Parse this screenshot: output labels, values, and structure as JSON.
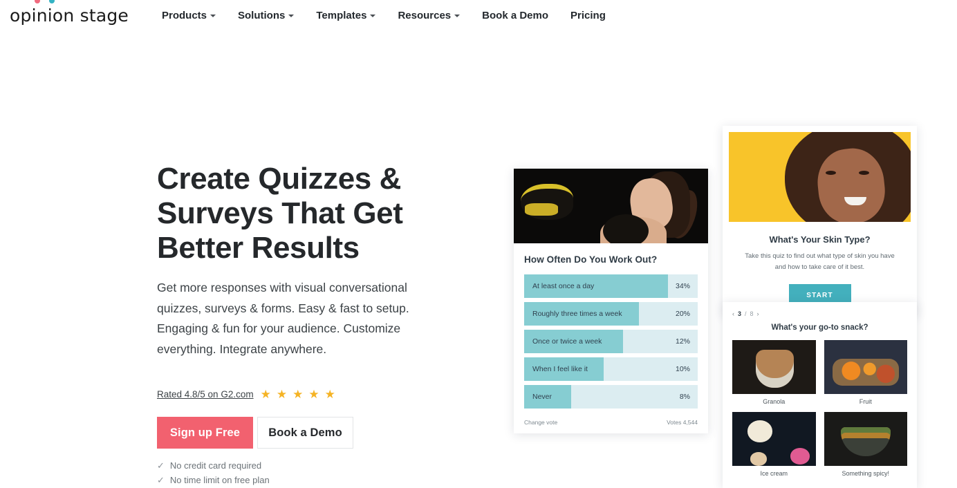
{
  "nav": {
    "logo_text": "opinion stage",
    "logo_dot_colors": [
      "#f06a7e",
      "#34b3c4"
    ],
    "items": [
      {
        "label": "Products",
        "has_dropdown": true,
        "icon": "chevron-down-icon"
      },
      {
        "label": "Solutions",
        "has_dropdown": true,
        "icon": "chevron-down-icon"
      },
      {
        "label": "Templates",
        "has_dropdown": true,
        "icon": "chevron-down-icon"
      },
      {
        "label": "Resources",
        "has_dropdown": true,
        "icon": "chevron-down-icon"
      },
      {
        "label": "Book a Demo",
        "has_dropdown": false,
        "icon": ""
      },
      {
        "label": "Pricing",
        "has_dropdown": false,
        "icon": ""
      }
    ]
  },
  "hero": {
    "headline": "Create Quizzes & Surveys That Get Better Results",
    "subhead": "Get more responses with visual conversational quizzes, surveys & forms. Easy & fast to setup. Engaging & fun for your audience. Customize everything. Integrate anywhere.",
    "rating": {
      "link_text": "Rated 4.8/5 on G2.com",
      "stars": 5,
      "star_glyph": "★",
      "star_color": "#f5b324"
    },
    "cta": {
      "primary_label": "Sign up Free",
      "primary_color": "#f2616f",
      "secondary_label": "Book a Demo"
    },
    "perks": [
      {
        "check": "✓",
        "label": "No credit card required"
      },
      {
        "check": "✓",
        "label": "No time limit on free plan"
      }
    ]
  },
  "poll_card": {
    "image_alt": "boxer-kissing-glove-image",
    "question": "How Often Do You Work Out?",
    "bar_fill_color": "#86cdd2",
    "bar_track_color": "#dcedf1",
    "options": [
      {
        "label": "At least once a day",
        "pct": "34%",
        "value": 34
      },
      {
        "label": "Roughly three times a week",
        "pct": "20%",
        "value": 20
      },
      {
        "label": "Once or twice a week",
        "pct": "12%",
        "value": 12
      },
      {
        "label": "When I feel like it",
        "pct": "10%",
        "value": 10
      },
      {
        "label": "Never",
        "pct": "8%",
        "value": 8
      }
    ],
    "footer_left": "Change vote",
    "footer_right": "Votes 4,544"
  },
  "quiz_card": {
    "image_alt": "woman-yellow-background-image",
    "title": "What's Your Skin Type?",
    "description": "Take this quiz to find out what type of skin you have and how to take care of it best.",
    "start_label": "START",
    "start_color": "#43b0bd"
  },
  "snack_card": {
    "pager": {
      "prev_icon": "chevron-left-icon",
      "next_icon": "chevron-right-icon",
      "current": "3",
      "separator": "/",
      "total": "8"
    },
    "question": "What's your go-to snack?",
    "options": [
      {
        "label": "Granola",
        "thumb": "granola-image"
      },
      {
        "label": "Fruit",
        "thumb": "fruit-image"
      },
      {
        "label": "Ice cream",
        "thumb": "ice-cream-image"
      },
      {
        "label": "Something spicy!",
        "thumb": "spicy-food-image"
      }
    ]
  }
}
